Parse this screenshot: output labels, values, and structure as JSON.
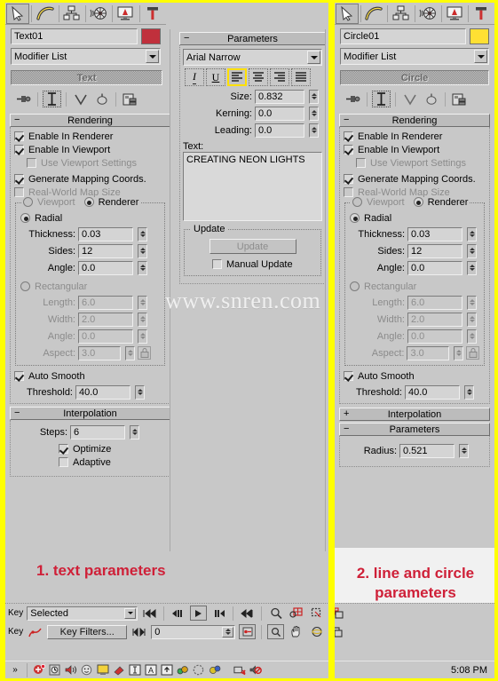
{
  "app": {
    "name": "3ds Max Command Panel"
  },
  "left_panel": {
    "tabs": [
      {
        "name": "create-tab",
        "icon": "arrow-pointer-icon",
        "selected": true
      },
      {
        "name": "modify-tab",
        "icon": "bent-tube-icon",
        "selected": false
      },
      {
        "name": "hierarchy-tab",
        "icon": "hierarchy-icon",
        "selected": false
      },
      {
        "name": "motion-tab",
        "icon": "wheel-motion-icon",
        "selected": false
      },
      {
        "name": "display-tab",
        "icon": "monitor-display-icon",
        "selected": false
      },
      {
        "name": "utilities-tab",
        "icon": "hammer-icon",
        "selected": false
      }
    ],
    "object_name": "Text01",
    "object_color": "#c0303c",
    "modifier_list_label": "Modifier List",
    "stack_entry": "Text",
    "rendering": {
      "title": "Rendering",
      "enable_in_renderer": {
        "label": "Enable In Renderer",
        "checked": true
      },
      "enable_in_viewport": {
        "label": "Enable In Viewport",
        "checked": true
      },
      "use_viewport_settings": {
        "label": "Use Viewport Settings",
        "checked": false
      },
      "generate_mapping_coords": {
        "label": "Generate Mapping Coords.",
        "checked": true
      },
      "real_world_map_size": {
        "label": "Real-World Map Size",
        "checked": false
      },
      "viewport_radio": {
        "label": "Viewport",
        "selected": false
      },
      "renderer_radio": {
        "label": "Renderer",
        "selected": true
      },
      "radial": {
        "label": "Radial",
        "selected": true
      },
      "thickness": {
        "label": "Thickness:",
        "value": "0.03"
      },
      "sides": {
        "label": "Sides:",
        "value": "12"
      },
      "angle_radial": {
        "label": "Angle:",
        "value": "0.0"
      },
      "rectangular": {
        "label": "Rectangular",
        "selected": false
      },
      "length": {
        "label": "Length:",
        "value": "6.0"
      },
      "width": {
        "label": "Width:",
        "value": "2.0"
      },
      "angle_rect": {
        "label": "Angle:",
        "value": "0.0"
      },
      "aspect": {
        "label": "Aspect:",
        "value": "3.0"
      },
      "auto_smooth": {
        "label": "Auto Smooth",
        "checked": true
      },
      "threshold": {
        "label": "Threshold:",
        "value": "40.0"
      }
    },
    "interpolation": {
      "title": "Interpolation",
      "steps": {
        "label": "Steps:",
        "value": "6"
      },
      "optimize": {
        "label": "Optimize",
        "checked": true
      },
      "adaptive": {
        "label": "Adaptive",
        "checked": false
      }
    }
  },
  "mid_panel": {
    "title": "Parameters",
    "font": "Arial Narrow",
    "format_buttons": [
      {
        "name": "italic-button",
        "glyph": "I",
        "selected": false
      },
      {
        "name": "underline-button",
        "glyph": "U",
        "selected": false
      },
      {
        "name": "align-left-button",
        "glyph": "align-left-icon",
        "selected": true
      },
      {
        "name": "align-center-button",
        "glyph": "align-center-icon",
        "selected": false
      },
      {
        "name": "align-right-button",
        "glyph": "align-right-icon",
        "selected": false
      },
      {
        "name": "align-justify-button",
        "glyph": "align-justify-icon",
        "selected": false
      }
    ],
    "size": {
      "label": "Size:",
      "value": "0.832"
    },
    "kerning": {
      "label": "Kerning:",
      "value": "0.0"
    },
    "leading": {
      "label": "Leading:",
      "value": "0.0"
    },
    "text_label": "Text:",
    "text_value": "CREATING NEON LIGHTS",
    "update_group": "Update",
    "update_button": "Update",
    "manual_update": {
      "label": "Manual Update",
      "checked": false
    }
  },
  "right_panel": {
    "tabs": [
      {
        "name": "create-tab",
        "icon": "arrow-pointer-icon",
        "selected": true
      },
      {
        "name": "modify-tab",
        "icon": "bent-tube-icon",
        "selected": false
      },
      {
        "name": "hierarchy-tab",
        "icon": "hierarchy-icon",
        "selected": false
      },
      {
        "name": "motion-tab",
        "icon": "wheel-motion-icon",
        "selected": false
      },
      {
        "name": "display-tab",
        "icon": "monitor-display-icon",
        "selected": false
      },
      {
        "name": "utilities-tab",
        "icon": "hammer-icon",
        "selected": false
      }
    ],
    "object_name": "Circle01",
    "object_color": "#ffe033",
    "modifier_list_label": "Modifier List",
    "stack_entry": "Circle",
    "rendering": {
      "title": "Rendering",
      "enable_in_renderer": {
        "label": "Enable In Renderer",
        "checked": true
      },
      "enable_in_viewport": {
        "label": "Enable In Viewport",
        "checked": true
      },
      "use_viewport_settings": {
        "label": "Use Viewport Settings",
        "checked": false
      },
      "generate_mapping_coords": {
        "label": "Generate Mapping Coords.",
        "checked": true
      },
      "real_world_map_size": {
        "label": "Real-World Map Size",
        "checked": false
      },
      "viewport_radio": {
        "label": "Viewport",
        "selected": false
      },
      "renderer_radio": {
        "label": "Renderer",
        "selected": true
      },
      "radial": {
        "label": "Radial",
        "selected": true
      },
      "thickness": {
        "label": "Thickness:",
        "value": "0.03"
      },
      "sides": {
        "label": "Sides:",
        "value": "12"
      },
      "angle_radial": {
        "label": "Angle:",
        "value": "0.0"
      },
      "rectangular": {
        "label": "Rectangular",
        "selected": false
      },
      "length": {
        "label": "Length:",
        "value": "6.0"
      },
      "width": {
        "label": "Width:",
        "value": "2.0"
      },
      "angle_rect": {
        "label": "Angle:",
        "value": "0.0"
      },
      "aspect": {
        "label": "Aspect:",
        "value": "3.0"
      },
      "auto_smooth": {
        "label": "Auto Smooth",
        "checked": true
      },
      "threshold": {
        "label": "Threshold:",
        "value": "40.0"
      }
    },
    "interpolation_title": "Interpolation",
    "parameters": {
      "title": "Parameters",
      "radius": {
        "label": "Radius:",
        "value": "0.521"
      }
    }
  },
  "captions": {
    "left": "1. text parameters",
    "right_line1": "2.  line and circle",
    "right_line2": "parameters"
  },
  "watermark": "www.snren.com",
  "bottom_bar": {
    "key_label_1": "Key",
    "key_label_2": "Key",
    "key_mode_value": "Selected",
    "key_filters_button": "Key Filters...",
    "frame_value": "0",
    "time_display": "5:08 PM"
  },
  "colors": {
    "accent_yellow": "#ffff00",
    "caption_red": "#cf2038",
    "panel_gray": "#c8c8c8"
  }
}
